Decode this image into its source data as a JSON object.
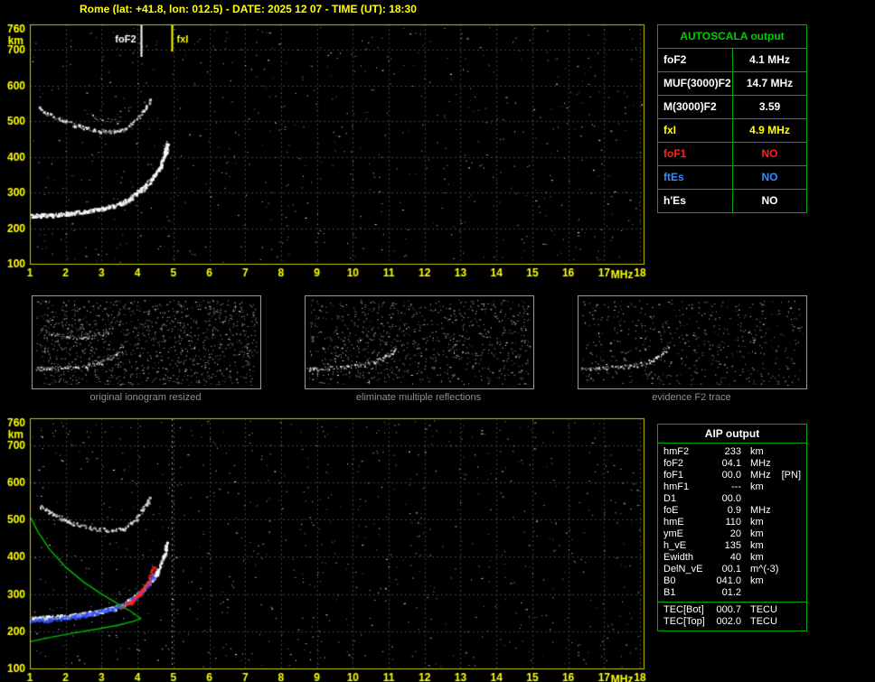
{
  "page": {
    "title": "Rome (lat: +41.8, lon: 012.5) - DATE: 2025 12 07 - TIME (UT): 18:30"
  },
  "colors": {
    "axis": "#ffff00",
    "border": "#c8c800",
    "grid": "#36453a",
    "table_border": "#00aa00",
    "header_green": "#00cc00",
    "caption_gray": "#8f8f8f",
    "trace_white": "#ffffff",
    "profile_green": "#00bb00",
    "trace_blue": "#3355ff",
    "trace_red": "#ff2828",
    "no_red": "#ff2020",
    "no_blue": "#2f8fff"
  },
  "autoscala": {
    "header": "AUTOSCALA output",
    "rows": [
      {
        "label": "foF2",
        "value": "4.1 MHz",
        "color": "#ffffff"
      },
      {
        "label": "MUF(3000)F2",
        "value": "14.7 MHz",
        "color": "#ffffff"
      },
      {
        "label": "M(3000)F2",
        "value": "3.59",
        "color": "#ffffff"
      },
      {
        "label": "fxI",
        "value": "4.9 MHz",
        "color": "#ffff00"
      },
      {
        "label": "foF1",
        "value": "NO",
        "color": "#ff2020"
      },
      {
        "label": "ftEs",
        "value": "NO",
        "color": "#2f8fff"
      },
      {
        "label": "h'Es",
        "value": "NO",
        "color": "#ffffff"
      }
    ]
  },
  "aip": {
    "header": "AIP output",
    "rows": [
      {
        "label": "hmF2",
        "value": "233",
        "unit": "km",
        "note": ""
      },
      {
        "label": "foF2",
        "value": "04.1",
        "unit": "MHz",
        "note": ""
      },
      {
        "label": "foF1",
        "value": "00.0",
        "unit": "MHz",
        "note": "[PN]"
      },
      {
        "label": "hmF1",
        "value": "---",
        "unit": "km",
        "note": ""
      },
      {
        "label": "D1",
        "value": "00.0",
        "unit": "",
        "note": ""
      },
      {
        "label": "foE",
        "value": "0.9",
        "unit": "MHz",
        "note": ""
      },
      {
        "label": "hmE",
        "value": "110",
        "unit": "km",
        "note": ""
      },
      {
        "label": "ymE",
        "value": "20",
        "unit": "km",
        "note": ""
      },
      {
        "label": "h_vE",
        "value": "135",
        "unit": "km",
        "note": ""
      },
      {
        "label": "Ewidth",
        "value": "40",
        "unit": "km",
        "note": ""
      },
      {
        "label": "DelN_vE",
        "value": "00.1",
        "unit": "m^(-3)",
        "note": ""
      },
      {
        "label": "B0",
        "value": "041.0",
        "unit": "km",
        "note": ""
      },
      {
        "label": "B1",
        "value": "01.2",
        "unit": "",
        "note": ""
      }
    ],
    "tec_rows": [
      {
        "label": "TEC[Bot]",
        "value": "000.7",
        "unit": "TECU"
      },
      {
        "label": "TEC[Top]",
        "value": "002.0",
        "unit": "TECU"
      }
    ]
  },
  "thumbnails": [
    {
      "caption": "original ionogram resized"
    },
    {
      "caption": "eliminate multiple reflections"
    },
    {
      "caption": "evidence F2 trace"
    }
  ],
  "chart_data": [
    {
      "id": "top",
      "type": "scatter",
      "title": "scaled ionogram",
      "xlabel": "MHz",
      "ylabel": "km",
      "xlabel_x": 17.5,
      "xlim": [
        1,
        18.1
      ],
      "ylim": [
        100,
        772
      ],
      "xticks": [
        1,
        2,
        3,
        4,
        5,
        6,
        7,
        8,
        9,
        10,
        11,
        12,
        13,
        14,
        15,
        16,
        17,
        18
      ],
      "yticks": [
        100,
        200,
        300,
        400,
        500,
        600,
        700,
        760
      ],
      "markers": [
        {
          "label": "foF2",
          "x": 4.1,
          "color": "#ffffff",
          "style": "tick",
          "len": 36,
          "side": "left"
        },
        {
          "label": "fxI",
          "x": 4.95,
          "color": "#ffff00",
          "style": "tick",
          "len": 30,
          "side": "right"
        }
      ],
      "traces": [
        {
          "name": "F2-first-hop",
          "color": "#ffffff",
          "style": "speckle",
          "width": 2,
          "density": 2.5,
          "points": [
            [
              1.02,
              236
            ],
            [
              1.5,
              238
            ],
            [
              2.0,
              242
            ],
            [
              2.5,
              248
            ],
            [
              3.0,
              256
            ],
            [
              3.4,
              266
            ],
            [
              3.7,
              280
            ],
            [
              3.95,
              298
            ],
            [
              4.2,
              320
            ],
            [
              4.45,
              348
            ],
            [
              4.62,
              378
            ],
            [
              4.75,
              412
            ],
            [
              4.82,
              445
            ]
          ]
        },
        {
          "name": "F2-second-hop",
          "color": "#e8e8e8",
          "style": "speckle",
          "width": 2,
          "density": 1.1,
          "points": [
            [
              1.25,
              538
            ],
            [
              1.7,
              512
            ],
            [
              2.2,
              492
            ],
            [
              2.7,
              478
            ],
            [
              3.2,
              472
            ],
            [
              3.6,
              478
            ],
            [
              3.9,
              498
            ],
            [
              4.15,
              530
            ],
            [
              4.35,
              565
            ]
          ]
        },
        {
          "name": "spread-echo",
          "color": "#cccccc",
          "style": "speckle",
          "width": 1,
          "density": 0.7,
          "points": [
            [
              2.5,
              523
            ],
            [
              3.0,
              506
            ],
            [
              3.5,
              500
            ]
          ]
        }
      ],
      "noise": {
        "count": 650,
        "seed": 11
      }
    },
    {
      "id": "bottom",
      "type": "scatter",
      "title": "ionogram with restored traces and profile",
      "xlabel": "MHz",
      "ylabel": "km",
      "xlabel_x": 17.5,
      "xlim": [
        1,
        18.1
      ],
      "ylim": [
        100,
        772
      ],
      "xticks": [
        1,
        2,
        3,
        4,
        5,
        6,
        7,
        8,
        9,
        10,
        11,
        12,
        13,
        14,
        15,
        16,
        17,
        18
      ],
      "yticks": [
        100,
        200,
        300,
        400,
        500,
        600,
        700,
        760
      ],
      "markers": [
        {
          "label": "",
          "x": 4.95,
          "color": "#9a9a9a",
          "style": "vline"
        }
      ],
      "traces": [
        {
          "name": "F2-first-hop",
          "color": "#ffffff",
          "style": "speckle",
          "width": 2,
          "density": 2.2,
          "points": [
            [
              1.02,
              236
            ],
            [
              1.5,
              238
            ],
            [
              2.0,
              242
            ],
            [
              2.5,
              248
            ],
            [
              3.0,
              256
            ],
            [
              3.4,
              266
            ],
            [
              3.7,
              280
            ],
            [
              3.95,
              298
            ],
            [
              4.2,
              320
            ],
            [
              4.45,
              348
            ],
            [
              4.62,
              378
            ],
            [
              4.75,
              412
            ],
            [
              4.82,
              445
            ]
          ]
        },
        {
          "name": "F2-second-hop",
          "color": "#e8e8e8",
          "style": "speckle",
          "width": 2,
          "density": 1.0,
          "points": [
            [
              1.25,
              538
            ],
            [
              1.7,
              512
            ],
            [
              2.2,
              492
            ],
            [
              2.7,
              478
            ],
            [
              3.2,
              472
            ],
            [
              3.6,
              478
            ],
            [
              3.9,
              498
            ],
            [
              4.15,
              530
            ],
            [
              4.35,
              565
            ]
          ]
        },
        {
          "name": "identified-trace-blue",
          "color": "#3355ff",
          "style": "speckle",
          "width": 2,
          "density": 2.0,
          "points": [
            [
              1.02,
              228
            ],
            [
              1.6,
              233
            ],
            [
              2.2,
              240
            ],
            [
              2.8,
              250
            ],
            [
              3.3,
              262
            ],
            [
              3.7,
              278
            ],
            [
              4.0,
              298
            ],
            [
              4.25,
              324
            ],
            [
              4.45,
              356
            ]
          ]
        },
        {
          "name": "restored-trace-red",
          "color": "#ff2828",
          "style": "speckle",
          "width": 2,
          "density": 1.8,
          "points": [
            [
              3.55,
              265
            ],
            [
              3.8,
              280
            ],
            [
              4.0,
              298
            ],
            [
              4.2,
              322
            ],
            [
              4.35,
              350
            ],
            [
              4.45,
              380
            ]
          ]
        },
        {
          "name": "profile-bottomside-green",
          "color": "#00bb00",
          "style": "line",
          "points": [
            [
              1.0,
              172
            ],
            [
              1.6,
              184
            ],
            [
              2.2,
              195
            ],
            [
              2.9,
              206
            ],
            [
              3.5,
              217
            ],
            [
              3.9,
              227
            ],
            [
              4.1,
              234
            ]
          ]
        },
        {
          "name": "profile-topside-green",
          "color": "#00bb00",
          "style": "line",
          "points": [
            [
              4.1,
              234
            ],
            [
              3.8,
              254
            ],
            [
              3.45,
              274
            ],
            [
              3.0,
              300
            ],
            [
              2.5,
              332
            ],
            [
              2.0,
              372
            ],
            [
              1.55,
              420
            ],
            [
              1.22,
              468
            ],
            [
              1.03,
              505
            ]
          ]
        }
      ],
      "noise": {
        "count": 800,
        "seed": 23
      }
    },
    {
      "id": "thumb1",
      "type": "scatter",
      "title": "original ionogram resized",
      "axes": false,
      "xlim": [
        1,
        10.5
      ],
      "ylim": [
        100,
        772
      ],
      "traces": [
        {
          "name": "F2-first-hop",
          "color": "#ffffff",
          "style": "speckle",
          "width": 1,
          "density": 1.6,
          "points": [
            [
              1.02,
              236
            ],
            [
              1.8,
              242
            ],
            [
              2.6,
              250
            ],
            [
              3.2,
              262
            ],
            [
              3.7,
              282
            ],
            [
              4.1,
              310
            ],
            [
              4.5,
              352
            ],
            [
              4.75,
              410
            ]
          ]
        },
        {
          "name": "F2-second-hop",
          "color": "#dddddd",
          "style": "speckle",
          "width": 1,
          "density": 1.0,
          "points": [
            [
              1.25,
              535
            ],
            [
              1.9,
              500
            ],
            [
              2.6,
              478
            ],
            [
              3.2,
              472
            ],
            [
              3.7,
              488
            ],
            [
              4.1,
              525
            ]
          ]
        }
      ],
      "noise": {
        "count": 1200,
        "seed": 31
      }
    },
    {
      "id": "thumb2",
      "type": "scatter",
      "title": "eliminate multiple reflections",
      "axes": false,
      "xlim": [
        1,
        10.5
      ],
      "ylim": [
        100,
        772
      ],
      "traces": [
        {
          "name": "F2-first-hop",
          "color": "#ffffff",
          "style": "speckle",
          "width": 1,
          "density": 1.6,
          "points": [
            [
              1.02,
              236
            ],
            [
              1.8,
              242
            ],
            [
              2.6,
              250
            ],
            [
              3.2,
              262
            ],
            [
              3.7,
              282
            ],
            [
              4.1,
              310
            ],
            [
              4.5,
              352
            ],
            [
              4.75,
              410
            ]
          ]
        }
      ],
      "noise": {
        "count": 900,
        "seed": 41
      }
    },
    {
      "id": "thumb3",
      "type": "scatter",
      "title": "evidence F2 trace",
      "axes": false,
      "xlim": [
        1,
        10.5
      ],
      "ylim": [
        100,
        772
      ],
      "traces": [
        {
          "name": "F2-first-hop",
          "color": "#ffffff",
          "style": "speckle",
          "width": 1,
          "density": 1.3,
          "points": [
            [
              1.02,
              236
            ],
            [
              1.8,
              242
            ],
            [
              2.6,
              250
            ],
            [
              3.2,
              262
            ],
            [
              3.7,
              282
            ],
            [
              4.1,
              310
            ],
            [
              4.5,
              352
            ],
            [
              4.75,
              410
            ]
          ]
        }
      ],
      "noise": {
        "count": 550,
        "seed": 51
      }
    }
  ]
}
